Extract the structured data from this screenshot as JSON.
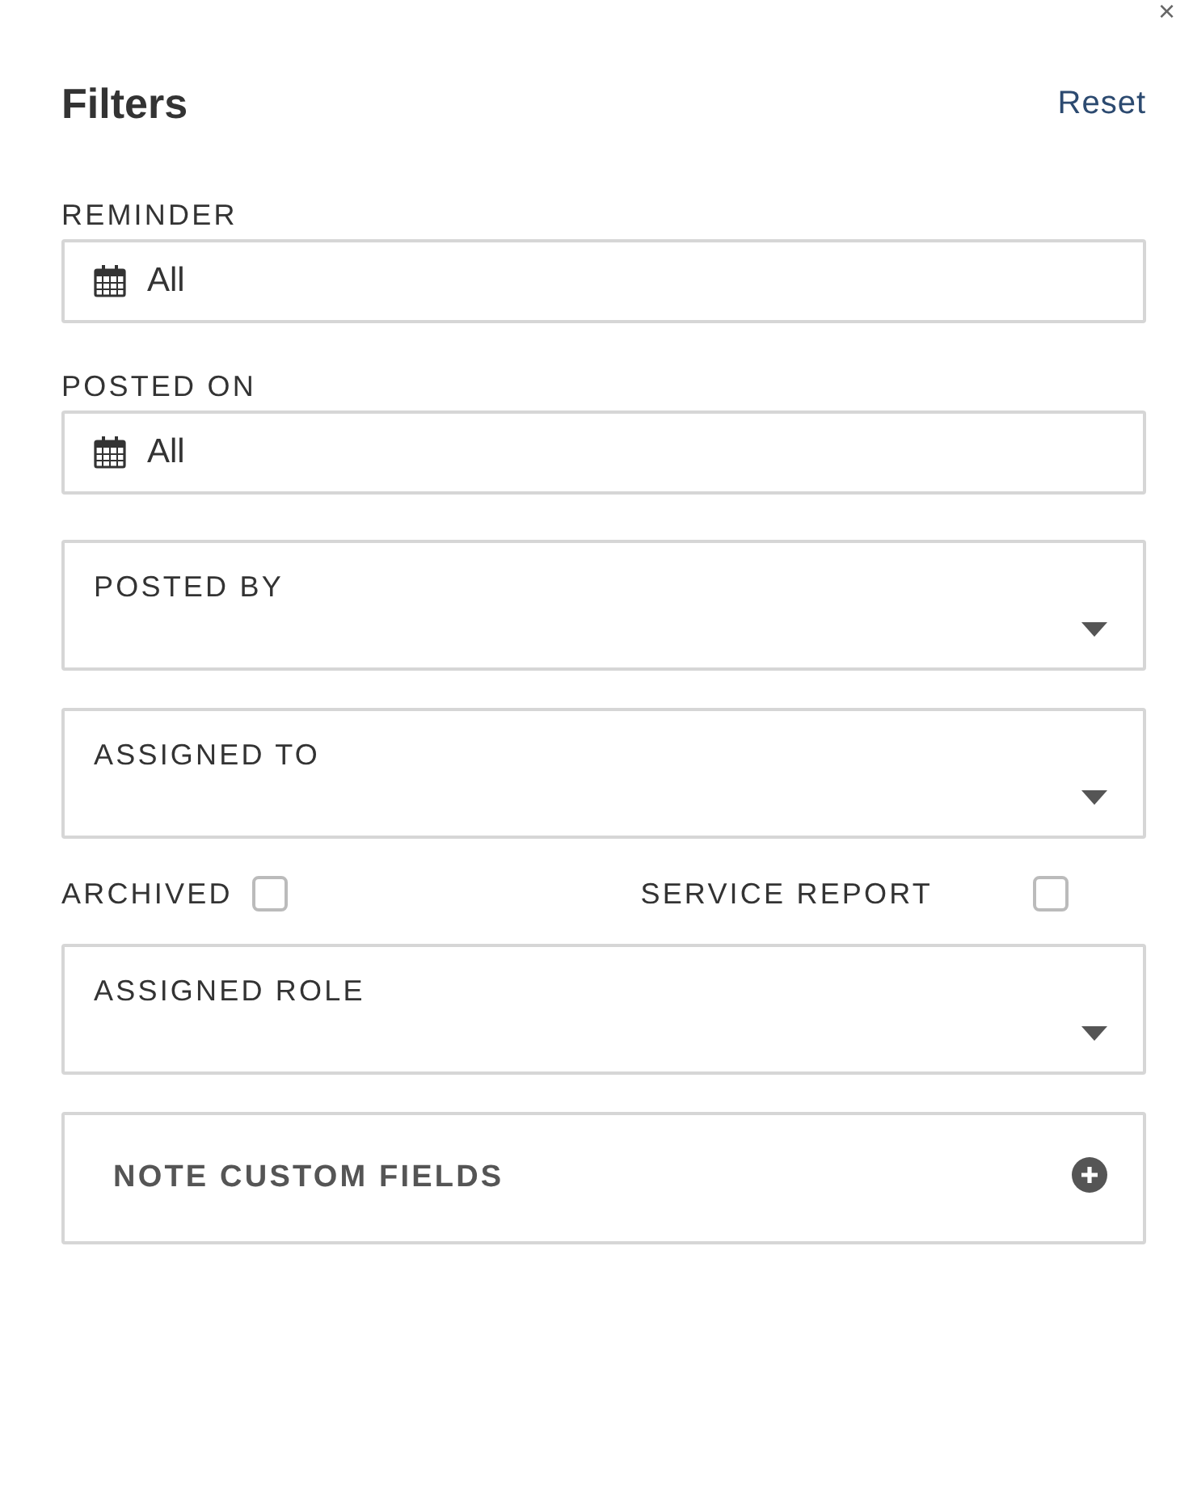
{
  "close_button": "×",
  "header": {
    "title": "Filters",
    "reset": "Reset"
  },
  "fields": [
    {
      "kind": "date",
      "label": "REMINDER",
      "value": "All"
    },
    {
      "kind": "date",
      "label": "POSTED ON",
      "value": "All"
    },
    {
      "kind": "select",
      "label": "POSTED BY"
    },
    {
      "kind": "select",
      "label": "ASSIGNED TO"
    },
    {
      "kind": "checkboxes",
      "items": [
        {
          "label": "ARCHIVED",
          "checked": false
        },
        {
          "label": "SERVICE REPORT",
          "checked": false
        }
      ]
    },
    {
      "kind": "select",
      "label": "ASSIGNED ROLE"
    },
    {
      "kind": "section",
      "label": "NOTE CUSTOM FIELDS",
      "expanded": false
    }
  ]
}
